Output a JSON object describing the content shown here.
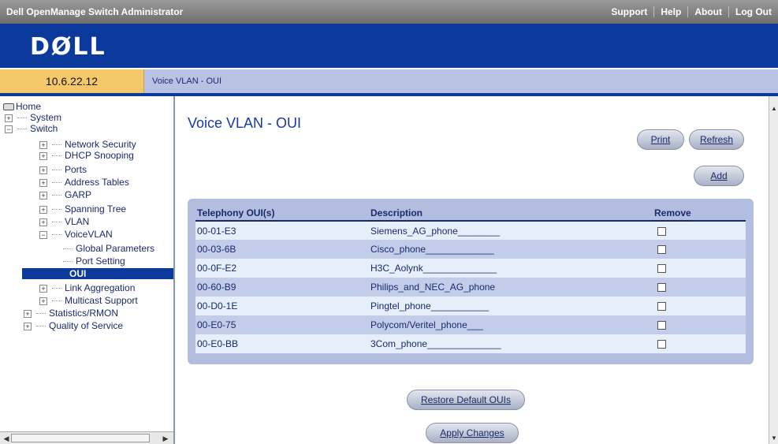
{
  "topbar": {
    "title": "Dell OpenManage Switch Administrator",
    "links": [
      "Support",
      "Help",
      "About",
      "Log Out"
    ]
  },
  "header": {
    "logo": "DØLL"
  },
  "address": {
    "ip": "10.6.22.12",
    "breadcrumb": "Voice VLAN - OUI"
  },
  "tree": {
    "home": "Home",
    "system": "System",
    "switch": "Switch",
    "network_security": "Network Security",
    "dhcp_snooping": "DHCP Snooping",
    "ports": "Ports",
    "address_tables": "Address Tables",
    "garp": "GARP",
    "spanning_tree": "Spanning Tree",
    "vlan": "VLAN",
    "voicevlan": "VoiceVLAN",
    "global_parameters": "Global Parameters",
    "port_setting": "Port Setting",
    "oui": "OUI",
    "link_aggregation": "Link Aggregation",
    "multicast_support": "Multicast Support",
    "statistics_rmon": "Statistics/RMON",
    "quality_of_service": "Quality of Service"
  },
  "main": {
    "title": "Voice VLAN - OUI",
    "print_label": "Print",
    "refresh_label": "Refresh",
    "add_label": "Add",
    "restore_label": "Restore Default OUIs",
    "apply_label": "Apply Changes",
    "table": {
      "headers": [
        "Telephony OUI(s)",
        "Description",
        "Remove"
      ],
      "rows": [
        {
          "oui": "00-01-E3",
          "desc": "Siemens_AG_phone________"
        },
        {
          "oui": "00-03-6B",
          "desc": "Cisco_phone_____________"
        },
        {
          "oui": "00-0F-E2",
          "desc": "H3C_Aolynk______________"
        },
        {
          "oui": "00-60-B9",
          "desc": "Philips_and_NEC_AG_phone"
        },
        {
          "oui": "00-D0-1E",
          "desc": "Pingtel_phone___________"
        },
        {
          "oui": "00-E0-75",
          "desc": "Polycom/Veritel_phone___"
        },
        {
          "oui": "00-E0-BB",
          "desc": "3Com_phone______________"
        }
      ]
    }
  },
  "colors": {
    "header_blue": "#0b3a9c",
    "ip_box": "#f5c96a",
    "crumb_bar": "#b8c3e3",
    "table_bg": "#b3bde0"
  }
}
